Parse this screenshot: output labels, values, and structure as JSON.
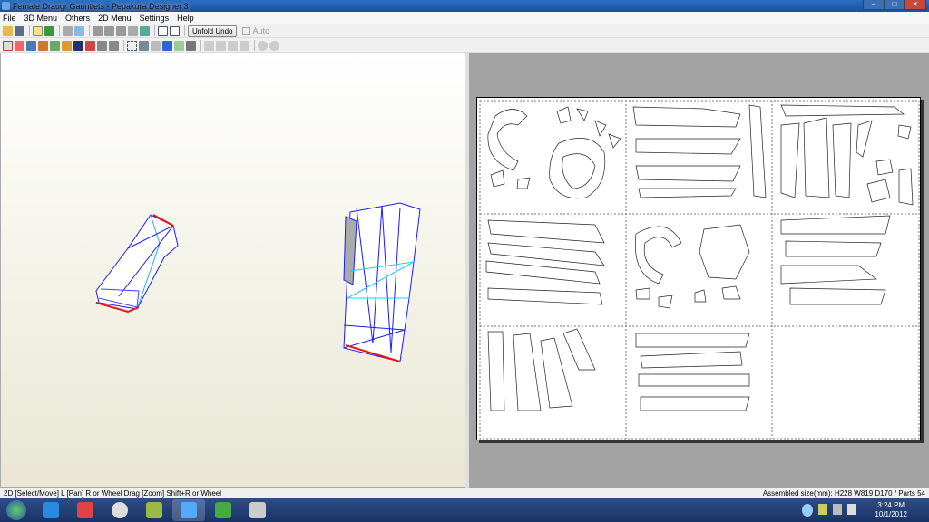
{
  "title": "Female Draugr Gauntlets - Pepakura Designer 3",
  "menu": [
    "File",
    "3D Menu",
    "Others",
    "2D Menu",
    "Settings",
    "Help"
  ],
  "toolbar": {
    "unfold_undo": "Unfold Undo",
    "auto": "Auto"
  },
  "status": {
    "left": "2D [Select/Move] L [Pan] R or Wheel Drag [Zoom] Shift+R or Wheel",
    "right": "Assembled size(mm): H228 W819 D170 / Parts 54"
  },
  "clock": {
    "time": "3:24 PM",
    "date": "10/1/2012"
  },
  "window_buttons": {
    "min": "–",
    "max": "□",
    "close": "✕"
  }
}
